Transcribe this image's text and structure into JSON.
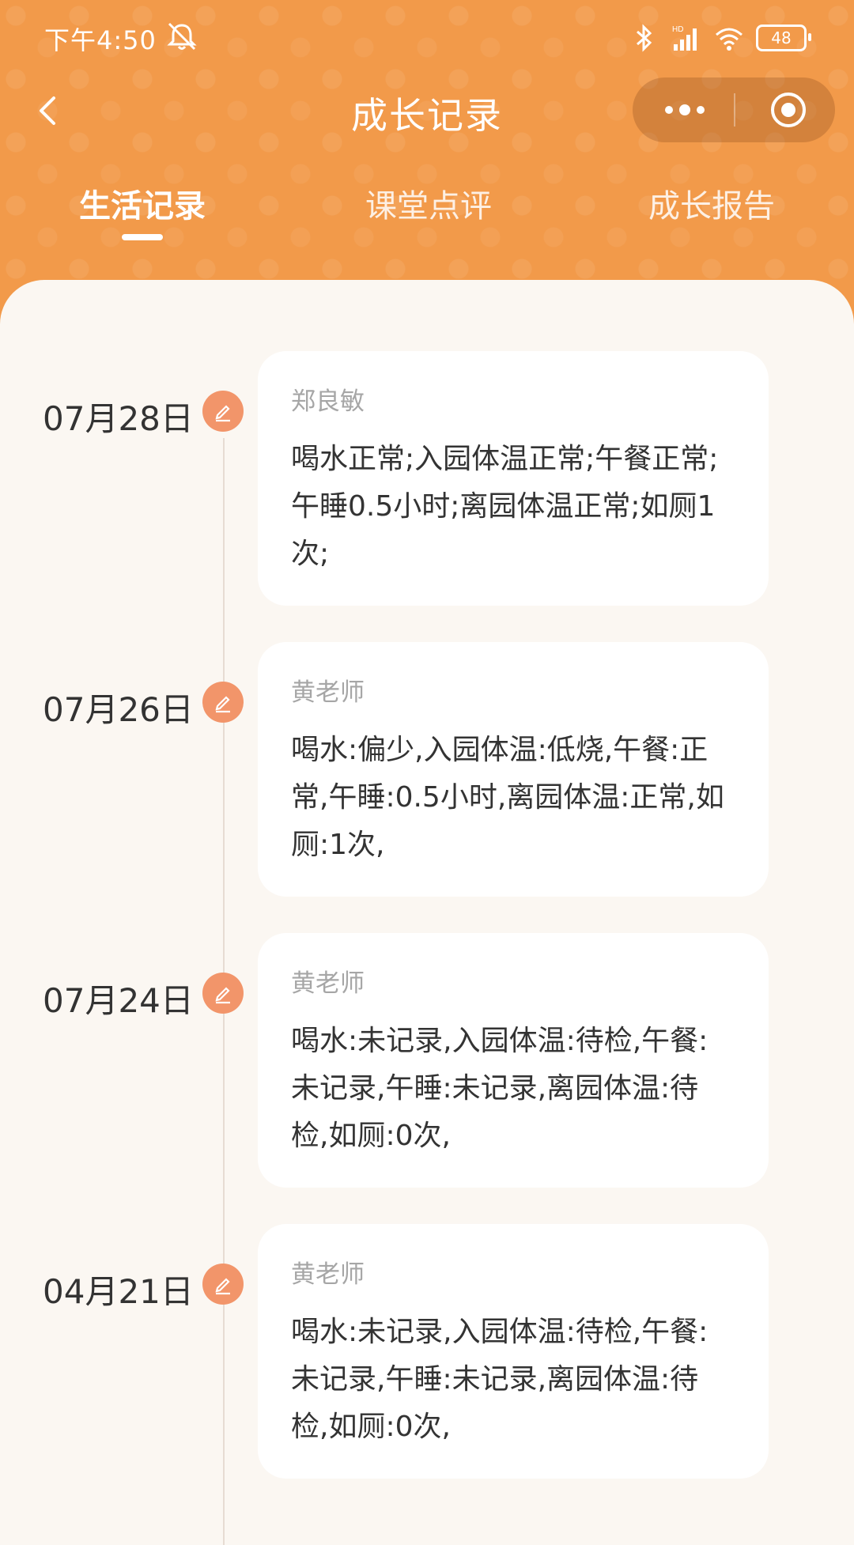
{
  "status_bar": {
    "time": "下午4:50",
    "signal_label": "HD",
    "battery": "48"
  },
  "nav": {
    "title": "成长记录"
  },
  "tabs": [
    {
      "label": "生活记录",
      "active": true
    },
    {
      "label": "课堂点评",
      "active": false
    },
    {
      "label": "成长报告",
      "active": false
    }
  ],
  "records": [
    {
      "date": "07月28日",
      "author": "郑良敏",
      "text": "喝水正常;入园体温正常;午餐正常;午睡0.5小时;离园体温正常;如厕1次;"
    },
    {
      "date": "07月26日",
      "author": "黄老师",
      "text": "喝水:偏少,入园体温:低烧,午餐:正常,午睡:0.5小时,离园体温:正常,如厕:1次,"
    },
    {
      "date": "07月24日",
      "author": "黄老师",
      "text": "喝水:未记录,入园体温:待检,午餐:未记录,午睡:未记录,离园体温:待检,如厕:0次,"
    },
    {
      "date": "04月21日",
      "author": "黄老师",
      "text": "喝水:未记录,入园体温:待检,午餐:未记录,午睡:未记录,离园体温:待检,如厕:0次,"
    }
  ],
  "colors": {
    "header": "#f29a4a",
    "badge": "#f2956a",
    "background": "#fbf7f2"
  }
}
